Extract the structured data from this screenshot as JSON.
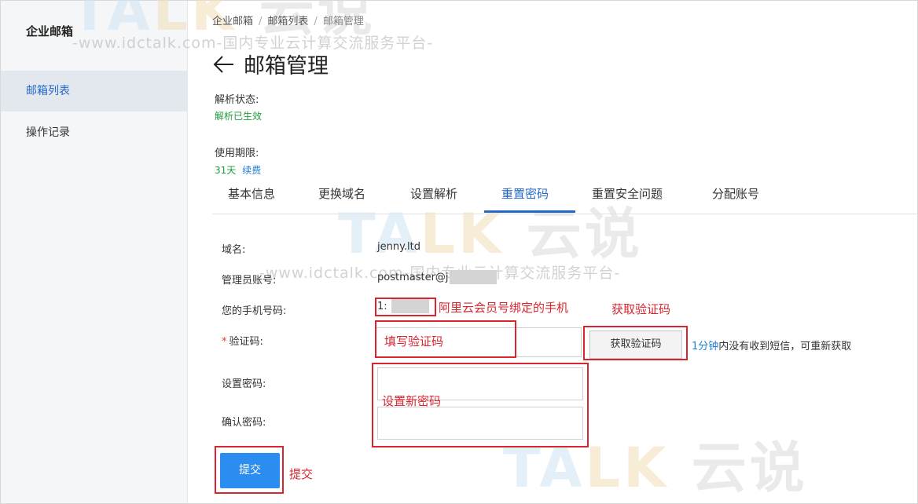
{
  "sidebar": {
    "brand": "企业邮箱",
    "items": [
      {
        "label": "邮箱列表",
        "active": true
      },
      {
        "label": "操作记录",
        "active": false
      }
    ]
  },
  "breadcrumb": {
    "items": [
      "企业邮箱",
      "邮箱列表",
      "邮箱管理"
    ],
    "separator": "/"
  },
  "header": {
    "back_icon": "arrow-left-icon",
    "title": "邮箱管理"
  },
  "status": {
    "resolve_label": "解析状态:",
    "resolve_value": "解析已生效",
    "period_label": "使用期限:",
    "period_value": "31天",
    "renew": "续费"
  },
  "tabs": [
    {
      "label": "基本信息",
      "active": false
    },
    {
      "label": "更换域名",
      "active": false
    },
    {
      "label": "设置解析",
      "active": false
    },
    {
      "label": "重置密码",
      "active": true
    },
    {
      "label": "重置安全问题",
      "active": false
    },
    {
      "label": "分配账号",
      "active": false
    }
  ],
  "form": {
    "domain_label": "域名:",
    "domain_value": "jenny.ltd",
    "admin_label": "管理员账号:",
    "admin_value": "postmaster@j",
    "phone_label": "您的手机号码:",
    "phone_value": "1:",
    "code_label": "验证码:",
    "get_code_button": "获取验证码",
    "hint_time": "1分钟",
    "hint_rest": "内没有收到短信，可重新获取",
    "new_password_label": "设置密码:",
    "confirm_password_label": "确认密码:",
    "submit_button": "提交"
  },
  "annotations": {
    "phone_note": "阿里云会员号绑定的手机",
    "get_code_note": "获取验证码",
    "code_note": "填写验证码",
    "password_note": "设置新密码",
    "submit_note": "提交"
  },
  "watermark": {
    "url_text": "-www.idctalk.com-国内专业云计算交流服务平台-",
    "logo_prefix": "TA",
    "logo_k": "LK",
    "logo_cn": "云说"
  },
  "colors": {
    "accent": "#2468c7",
    "submit": "#2c8df0",
    "success": "#1f9d3a",
    "annotation": "#d9252f"
  }
}
